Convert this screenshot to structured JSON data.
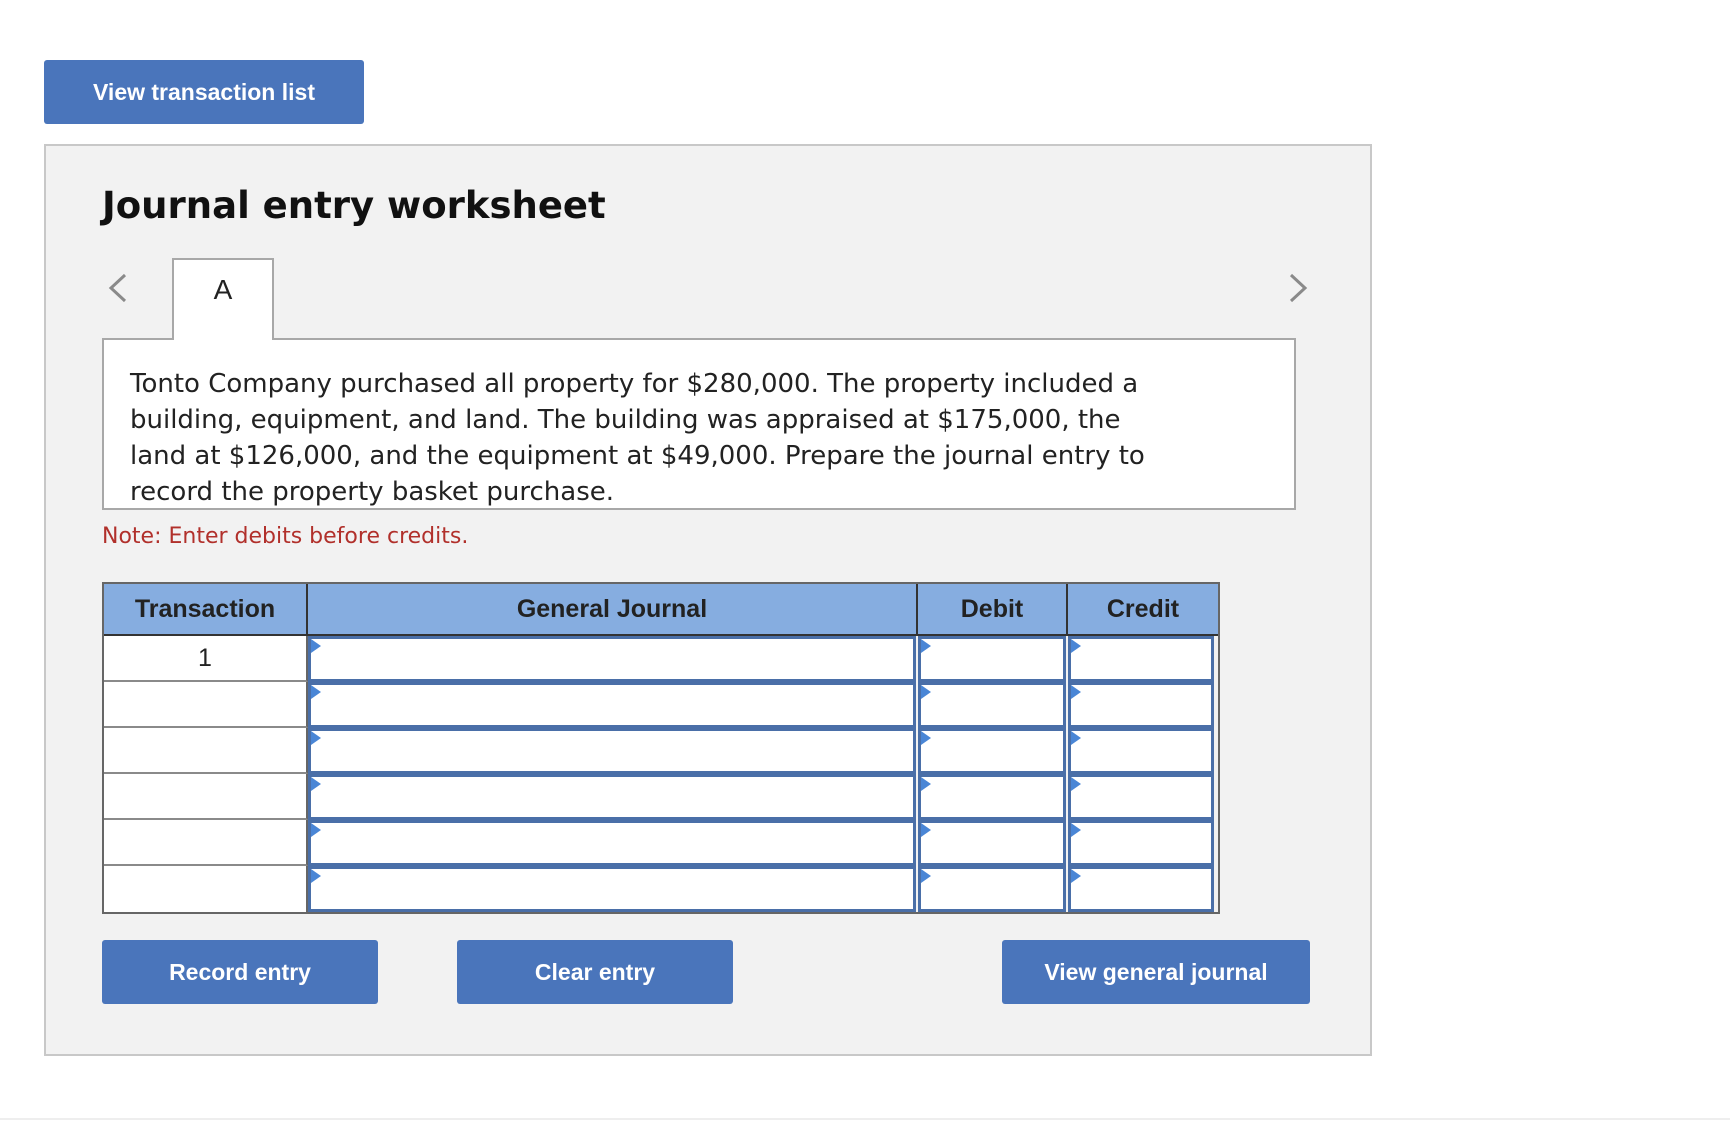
{
  "header": {
    "view_transaction_list_label": "View transaction list"
  },
  "worksheet": {
    "title": "Journal entry worksheet",
    "prev_icon": "chevron-left-icon",
    "next_icon": "chevron-right-icon",
    "tabs": [
      {
        "label": "A",
        "active": true
      }
    ],
    "problem_text": "Tonto Company purchased all property for $280,000. The property included a building, equipment, and land. The building was appraised at $175,000, the land at $126,000, and the equipment at $49,000. Prepare the journal entry to record the property basket purchase.",
    "note": "Note: Enter debits before credits."
  },
  "journal": {
    "columns": {
      "transaction": "Transaction",
      "general_journal": "General Journal",
      "debit": "Debit",
      "credit": "Credit"
    },
    "rows": [
      {
        "transaction": "1",
        "general_journal": "",
        "debit": "",
        "credit": ""
      },
      {
        "transaction": "",
        "general_journal": "",
        "debit": "",
        "credit": ""
      },
      {
        "transaction": "",
        "general_journal": "",
        "debit": "",
        "credit": ""
      },
      {
        "transaction": "",
        "general_journal": "",
        "debit": "",
        "credit": ""
      },
      {
        "transaction": "",
        "general_journal": "",
        "debit": "",
        "credit": ""
      },
      {
        "transaction": "",
        "general_journal": "",
        "debit": "",
        "credit": ""
      }
    ]
  },
  "actions": {
    "record_entry_label": "Record entry",
    "clear_entry_label": "Clear entry",
    "view_general_journal_label": "View general journal"
  },
  "colors": {
    "button": "#4a75bb",
    "header_row": "#86ade0",
    "note": "#b1302b",
    "panel_background": "#f2f2f2"
  }
}
